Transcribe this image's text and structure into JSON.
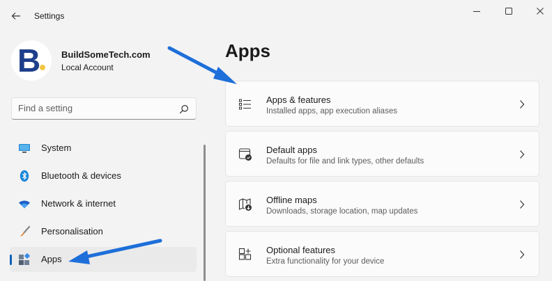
{
  "window": {
    "title": "Settings"
  },
  "account": {
    "avatar_letter": "B",
    "name": "BuildSomeTech.com",
    "type": "Local Account"
  },
  "search": {
    "placeholder": "Find a setting"
  },
  "sidebar": {
    "items": [
      {
        "label": "System",
        "icon": "monitor-icon"
      },
      {
        "label": "Bluetooth & devices",
        "icon": "bluetooth-icon"
      },
      {
        "label": "Network & internet",
        "icon": "wifi-icon"
      },
      {
        "label": "Personalisation",
        "icon": "paintbrush-icon"
      },
      {
        "label": "Apps",
        "icon": "apps-icon",
        "selected": true
      }
    ]
  },
  "main": {
    "title": "Apps",
    "cards": [
      {
        "title": "Apps & features",
        "description": "Installed apps, app execution aliases",
        "icon": "list-icon"
      },
      {
        "title": "Default apps",
        "description": "Defaults for file and link types, other defaults",
        "icon": "default-apps-icon"
      },
      {
        "title": "Offline maps",
        "description": "Downloads, storage location, map updates",
        "icon": "map-download-icon"
      },
      {
        "title": "Optional features",
        "description": "Extra functionality for your device",
        "icon": "add-features-icon"
      }
    ]
  },
  "colors": {
    "accent": "#005fb8",
    "annotation_arrow": "#1e6fd9",
    "background": "#f3f3f3",
    "card": "#fbfbfb"
  }
}
